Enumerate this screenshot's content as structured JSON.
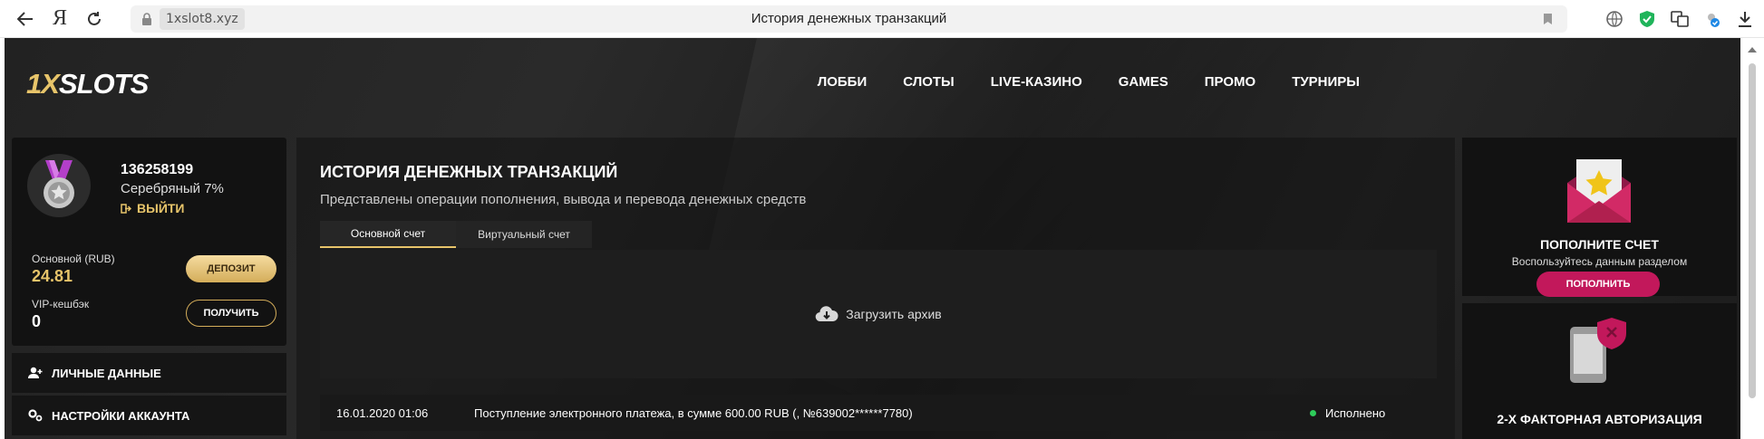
{
  "browser": {
    "domain": "1xslot8.xyz",
    "page_title": "История денежных транзакций",
    "yandex_glyph": "Я"
  },
  "site": {
    "logo_prefix": "1X",
    "logo_suffix": "SLOTS",
    "nav": [
      "ЛОББИ",
      "СЛОТЫ",
      "LIVE-КАЗИНО",
      "GAMES",
      "ПРОМО",
      "ТУРНИРЫ"
    ]
  },
  "profile": {
    "user_id": "136258199",
    "level": "Серебряный 7%",
    "logout_label": "ВЫЙТИ",
    "balance_label": "Основной (RUB)",
    "balance_value": "24.81",
    "deposit_label": "ДЕПОЗИТ",
    "vip_label": "VIP-кешбэк",
    "vip_value": "0",
    "receive_label": "ПОЛУЧИТЬ"
  },
  "side_menu": [
    {
      "label": "ЛИЧНЫЕ ДАННЫЕ",
      "icon": "user-add-icon"
    },
    {
      "label": "НАСТРОЙКИ АККАУНТА",
      "icon": "settings-icon"
    }
  ],
  "content": {
    "title": "ИСТОРИЯ ДЕНЕЖНЫХ ТРАНЗАКЦИЙ",
    "subtitle": "Представлены операции пополнения, вывода и перевода денежных средств",
    "tabs": [
      {
        "label": "Основной счет",
        "active": true
      },
      {
        "label": "Виртуальный счет",
        "active": false
      }
    ],
    "archive_label": "Загрузить архив",
    "transactions": [
      {
        "date": "16.01.2020 01:06",
        "description": "Поступление электронного платежа, в сумме 600.00 RUB (, №639002******7780)",
        "status": "Исполнено"
      }
    ]
  },
  "right_panel": {
    "promo_title": "ПОПОЛНИТЕ СЧЕТ",
    "promo_subtitle": "Воспользуйтесь данным разделом",
    "promo_button": "ПОПОЛНИТЬ",
    "twofa_title": "2-Х ФАКТОРНАЯ АВТОРИЗАЦИЯ"
  },
  "colors": {
    "accent_gold": "#e7c46a",
    "accent_pink": "#c2185b",
    "status_green": "#2ecc5a"
  }
}
